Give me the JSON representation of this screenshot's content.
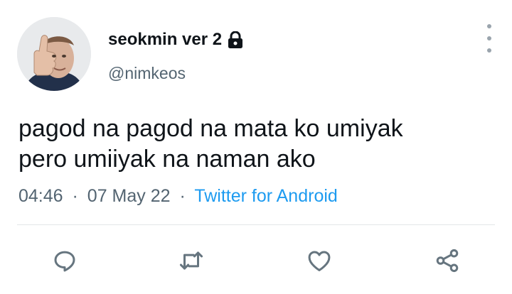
{
  "user": {
    "display_name": "seokmin ver 2",
    "handle": "@nimkeos",
    "avatar_icon": "profile-photo",
    "lock_icon": "lock-icon"
  },
  "tweet": {
    "lines": [
      "pagod na pagod na mata ko umiyak",
      "pero umiiyak na naman ako"
    ],
    "time": "04:46",
    "date": "07 May 22",
    "separator": "·",
    "source": "Twitter for Android"
  },
  "actions": [
    {
      "icon": "reply-icon"
    },
    {
      "icon": "retweet-icon"
    },
    {
      "icon": "like-icon"
    },
    {
      "icon": "share-icon"
    }
  ],
  "colors": {
    "text": "#0f1419",
    "secondary": "#536471",
    "link": "#1d9bf0",
    "icon": "#66757f"
  }
}
